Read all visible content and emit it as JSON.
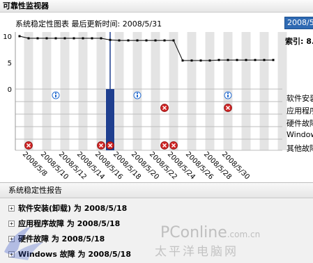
{
  "window": {
    "title": "可靠性监视器"
  },
  "chart_header": {
    "title_prefix": "系统稳定性图表",
    "updated_label": "最后更新时间: 2008/5/31",
    "date_selector_value": "2008/5/"
  },
  "index_label": "索引: 8.",
  "row_labels": [
    "软件安装",
    "应用程序",
    "硬件故障",
    "Window",
    "其他故障"
  ],
  "report": {
    "header": "系统稳定性报告",
    "items": [
      {
        "label": "软件安装(卸载) 为 2008/5/18"
      },
      {
        "label": "应用程序故障 为 2008/5/18"
      },
      {
        "label": "硬件故障 为 2008/5/18"
      },
      {
        "label": "Windows 故障 为 2008/5/18"
      }
    ]
  },
  "watermark": {
    "brand": "PConline",
    "suffix": ".com.cn",
    "cn": "太平洋电脑网"
  },
  "colors": {
    "selected_column": "#1f3f8f",
    "error_red": "#d02424",
    "info_blue": "#2a6fd1",
    "stripe": "#e4e4e4",
    "line": "#000000"
  },
  "chart_data": {
    "type": "line",
    "title": "系统稳定性图表",
    "y_ticks": [
      10,
      5,
      0
    ],
    "ylim": [
      0,
      10
    ],
    "x_tick_labels": [
      "2008/5/8",
      "2008/5/10",
      "2008/5/12",
      "2008/5/14",
      "2008/5/16",
      "2008/5/18",
      "2008/5/20",
      "2008/5/22",
      "2008/5/24",
      "2008/5/26",
      "2008/5/28",
      "2008/5/30"
    ],
    "selected_index": 10,
    "stability_index": [
      10,
      9.6,
      9.6,
      9.6,
      9.6,
      9.6,
      9.6,
      9.6,
      9.6,
      9.6,
      9.3,
      9.2,
      9.2,
      9.2,
      9.2,
      9.2,
      9.2,
      9.2,
      5.4,
      5.4,
      5.4,
      5.4,
      5.5,
      5.5,
      5.5,
      5.5,
      5.5,
      5.5,
      5.5
    ],
    "events": {
      "software_install": [
        4,
        13,
        23
      ],
      "application_failure": [
        16,
        23
      ],
      "hardware_failure": [],
      "windows_failure": [],
      "misc_failure": [
        1,
        9,
        10,
        16,
        17
      ]
    }
  }
}
